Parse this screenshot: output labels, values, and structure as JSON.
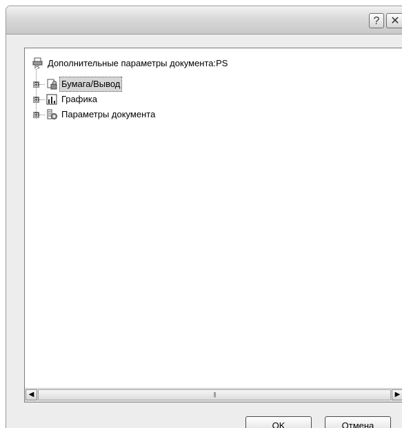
{
  "window": {
    "help_label": "?",
    "close_label": "✕"
  },
  "tree": {
    "root": {
      "label": "Дополнительные параметры документа:PS",
      "icon": "printer-ps-icon"
    },
    "items": [
      {
        "label": "Бумага/Вывод",
        "icon": "paper-output-icon",
        "expander": "⊞",
        "selected": true
      },
      {
        "label": "Графика",
        "icon": "graphics-chart-icon",
        "expander": "⊞",
        "selected": false
      },
      {
        "label": "Параметры документа",
        "icon": "document-options-icon",
        "expander": "⊞",
        "selected": false
      }
    ]
  },
  "scrollbar": {
    "left_arrow": "◀",
    "right_arrow": "▶",
    "grip": "|||"
  },
  "buttons": {
    "ok": "OK",
    "cancel": "Отмена"
  },
  "colors": {
    "dialog_background": "#ededed",
    "selection": "#d6d6d6"
  }
}
